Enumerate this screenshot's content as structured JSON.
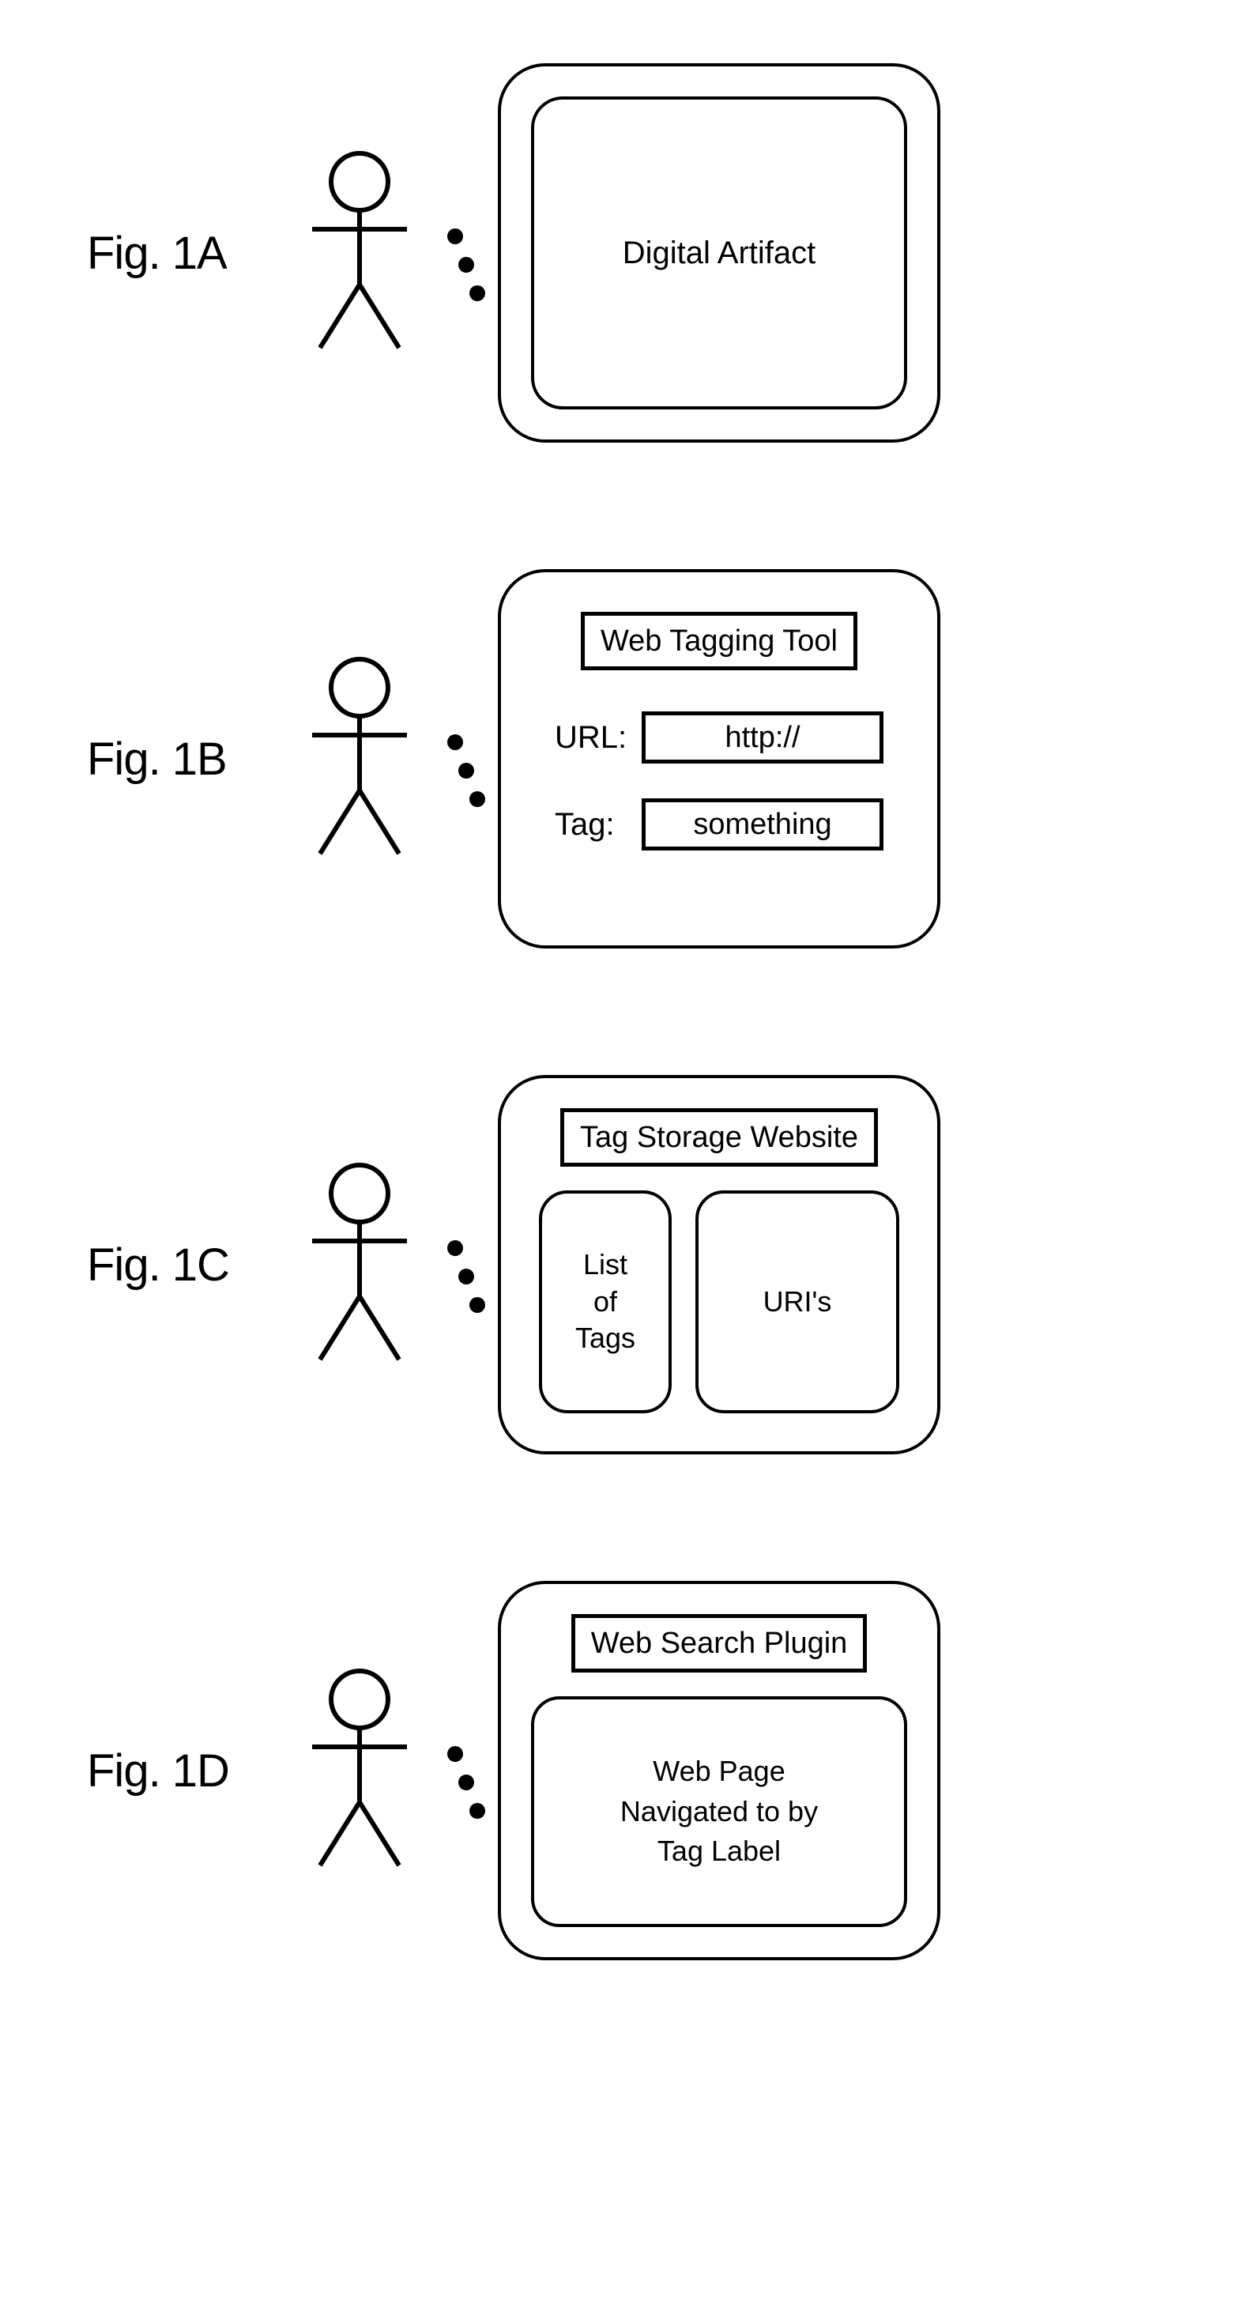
{
  "figA": {
    "label": "Fig. 1A",
    "content": "Digital Artifact"
  },
  "figB": {
    "label": "Fig. 1B",
    "title": "Web Tagging Tool",
    "urlLabel": "URL:",
    "urlValue": "http://",
    "tagLabel": "Tag:",
    "tagValue": "something"
  },
  "figC": {
    "label": "Fig. 1C",
    "title": "Tag Storage Website",
    "leftCol": "List\nof\nTags",
    "rightCol": "URI's"
  },
  "figD": {
    "label": "Fig. 1D",
    "title": "Web Search Plugin",
    "panel": "Web Page\nNavigated to by\nTag Label"
  }
}
